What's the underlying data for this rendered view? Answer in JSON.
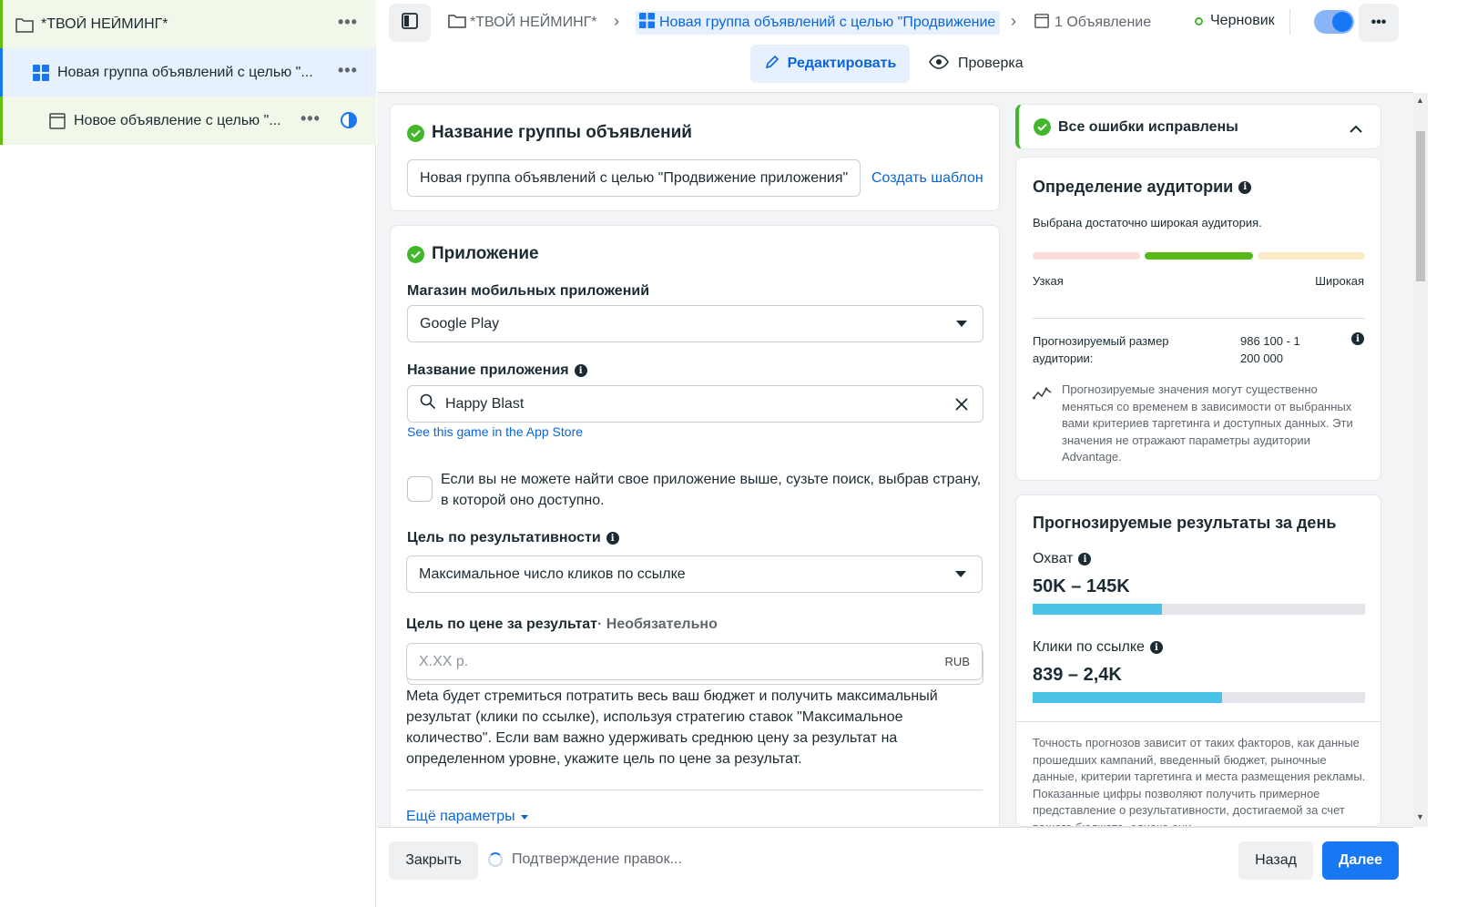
{
  "sidebar": {
    "items": [
      {
        "label": "*ТВОЙ НЕЙМИНГ*",
        "icon": "folder-icon"
      },
      {
        "label": "Новая группа объявлений с целью \"...",
        "icon": "grid-icon"
      },
      {
        "label": "Новое объявление с целью \"...",
        "icon": "ad-icon"
      }
    ],
    "more": "•••"
  },
  "topbar": {
    "breadcrumbs": [
      "*ТВОЙ НЕЙМИНГ*",
      "Новая группа объявлений с целью \"Продвижение приложения\"",
      "1 Объявление"
    ],
    "status": "Черновик",
    "more": "•••",
    "tabs": {
      "edit": "Редактировать",
      "review": "Проверка"
    }
  },
  "adset_name": {
    "title": "Название группы объявлений",
    "value": "Новая группа объявлений с целью \"Продвижение приложения\"",
    "template_link": "Создать шаблон"
  },
  "app": {
    "title": "Приложение",
    "store_label": "Магазин мобильных приложений",
    "store_value": "Google Play",
    "app_name_label": "Название приложения",
    "app_name_value": "Happy Blast",
    "store_link": "See this game in the App Store",
    "checkbox_text": "Если вы не можете найти свое приложение выше, сузьте поиск, выбрав страну, в которой оно доступно.",
    "performance_goal_label": "Цель по результативности",
    "performance_goal_value": "Максимальное число кликов по ссылке",
    "cost_goal_label": "Цель по цене за результат",
    "cost_goal_optional": " · Необязательно",
    "cost_placeholder": "X.XX р.",
    "currency": "RUB",
    "cost_description": "Meta будет стремиться потратить весь ваш бюджет и получить максимальный результат (клики по ссылке), используя стратегию ставок \"Максимальное количество\". Если вам важно удерживать среднюю цену за результат на определенном уровне, укажите цель по цене за результат.",
    "more_params": "Ещё параметры"
  },
  "errors": {
    "title": "Все ошибки исправлены"
  },
  "audience": {
    "title": "Определение аудитории",
    "subtitle": "Выбрана достаточно широкая аудитория.",
    "narrow": "Узкая",
    "wide": "Широкая",
    "size_label": "Прогнозируемый размер аудитории:",
    "size_value": "986 100 - 1 200 000",
    "note": "Прогнозируемые значения могут существенно меняться со временем в зависимости от выбранных вами критериев таргетинга и доступных данных. Эти значения не отражают параметры аудитории Advantage."
  },
  "daily": {
    "title": "Прогнозируемые результаты за день",
    "reach_label": "Охват",
    "reach_value": "50K – 145K",
    "reach_fill": 0.39,
    "clicks_label": "Клики по ссылке",
    "clicks_value": "839 – 2,4K",
    "clicks_fill": 0.57,
    "disclaimer": "Точность прогнозов зависит от таких факторов, как данные прошедших кампаний, введенный бюджет, рыночные данные, критерии таргетинга и места размещения рекламы. Показанные цифры позволяют получить примерное представление о результативности, достигаемой за счет вашего бюджета, однако они"
  },
  "bottombar": {
    "close": "Закрыть",
    "status": "Подтверждение правок...",
    "back": "Назад",
    "next": "Далее"
  },
  "colors": {
    "accent": "#1877f2",
    "success": "#42b72a",
    "bar": "#4bc2e8"
  }
}
